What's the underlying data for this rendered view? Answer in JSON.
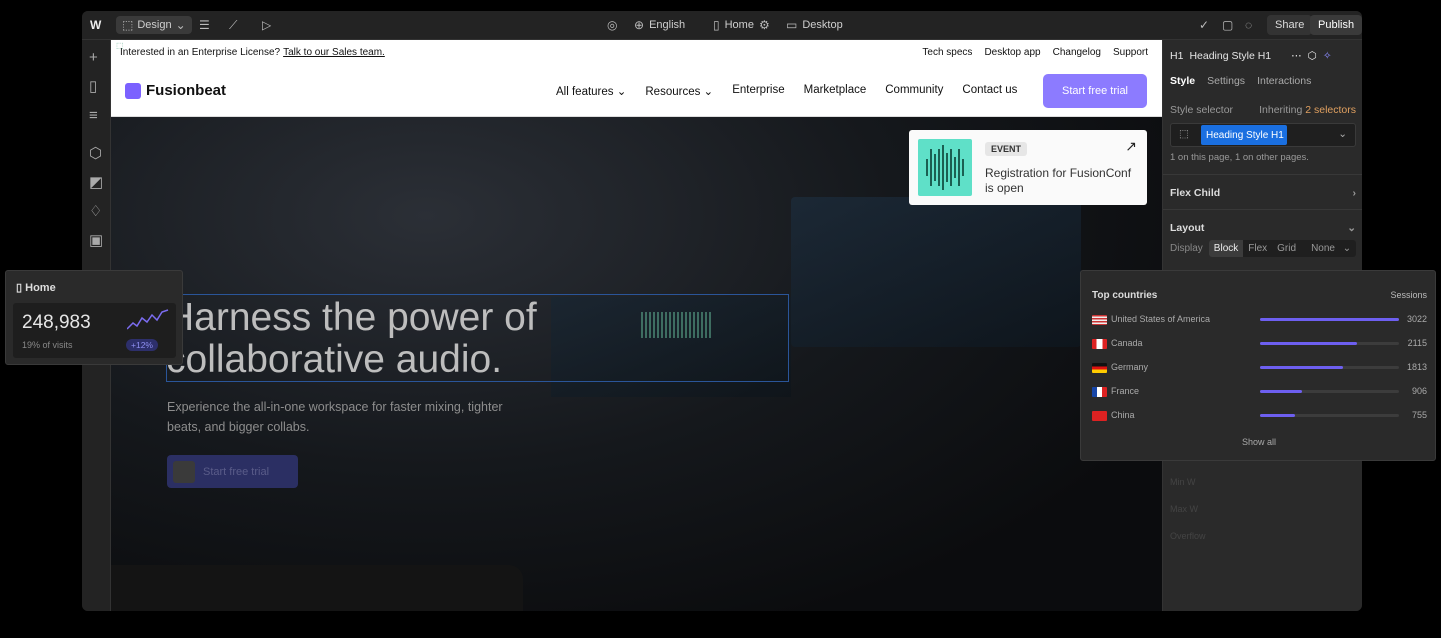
{
  "topbar": {
    "mode": "Design",
    "language": "English",
    "page": "Home",
    "breakpoint": "Desktop",
    "share": "Share",
    "publish": "Publish"
  },
  "site": {
    "banner_text": "Interested in an Enterprise License?",
    "banner_link": "Talk to our Sales team.",
    "utility_links": [
      "Tech specs",
      "Desktop app",
      "Changelog",
      "Support"
    ],
    "brand": "Fusionbeat",
    "nav": [
      "All features",
      "Resources",
      "Enterprise",
      "Marketplace",
      "Community",
      "Contact us"
    ],
    "cta": "Start free trial",
    "hero_title_1": "Harness the power of",
    "hero_title_2": "collaborative audio.",
    "hero_sub": "Experience the all-in-one workspace for faster mixing, tighter beats, and bigger collabs.",
    "hero_button": "Start free trial",
    "event_tag": "EVENT",
    "event_text": "Registration for FusionConf is open"
  },
  "panel": {
    "element_tag": "H1",
    "element_name": "Heading Style H1",
    "tabs": [
      "Style",
      "Settings",
      "Interactions"
    ],
    "style_selector_label": "Style selector",
    "inheriting_label": "Inheriting",
    "inheriting_value": "2 selectors",
    "selector_chip": "Heading Style H1",
    "selector_note": "1 on this page, 1 on other pages.",
    "section_flex_child": "Flex Child",
    "section_layout": "Layout",
    "display_label": "Display",
    "display_options": [
      "Block",
      "Flex",
      "Grid",
      "None"
    ],
    "faded_rows": [
      "Min W",
      "Max W",
      "Overflow"
    ]
  },
  "home_card": {
    "title": "Home",
    "value": "248,983",
    "subtitle": "19% of visits",
    "badge": "+12%"
  },
  "countries": {
    "title": "Top countries",
    "metric": "Sessions",
    "rows": [
      {
        "name": "United States of America",
        "value": "3022",
        "fraction": 1.0
      },
      {
        "name": "Canada",
        "value": "2115",
        "fraction": 0.7
      },
      {
        "name": "Germany",
        "value": "1813",
        "fraction": 0.6
      },
      {
        "name": "France",
        "value": "906",
        "fraction": 0.3
      },
      {
        "name": "China",
        "value": "755",
        "fraction": 0.25
      }
    ],
    "show_all": "Show all"
  }
}
